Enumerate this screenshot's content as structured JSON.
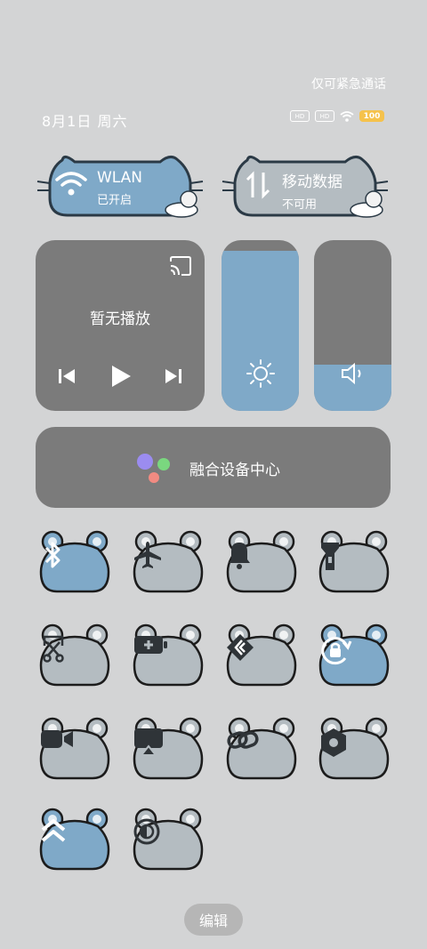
{
  "status": {
    "emergency": "仅可紧急通话",
    "date": "8月1日 周六",
    "battery": "100",
    "hd_badge": "HD",
    "signal_badge": "HD"
  },
  "tiles": {
    "wlan": {
      "title": "WLAN",
      "subtitle": "已开启"
    },
    "mobile": {
      "title": "移动数据",
      "subtitle": "不可用"
    }
  },
  "media": {
    "label": "暂无播放"
  },
  "sliders": {
    "brightness_level": 0.94,
    "volume_level": 0.27
  },
  "fusion": {
    "label": "融合设备中心"
  },
  "toggles": [
    {
      "icon": "bluetooth-icon",
      "active": true
    },
    {
      "icon": "airplane-icon",
      "active": false
    },
    {
      "icon": "bell-icon",
      "active": false
    },
    {
      "icon": "flashlight-icon",
      "active": false
    },
    {
      "icon": "screenshot-icon",
      "active": false
    },
    {
      "icon": "battery-saver-icon",
      "active": false
    },
    {
      "icon": "nfc-icon",
      "active": false
    },
    {
      "icon": "rotation-lock-icon",
      "active": true
    },
    {
      "icon": "screen-record-icon",
      "active": false
    },
    {
      "icon": "screen-cast-icon",
      "active": false
    },
    {
      "icon": "link-icon",
      "active": false
    },
    {
      "icon": "settings-icon",
      "active": false
    },
    {
      "icon": "speed-boost-icon",
      "active": true
    },
    {
      "icon": "dark-mode-icon",
      "active": false
    }
  ],
  "colors": {
    "active": "#7fa9c8",
    "inactive": "#b4bcc1",
    "panel": "#7b7b7b"
  },
  "edit": {
    "label": "编辑"
  }
}
